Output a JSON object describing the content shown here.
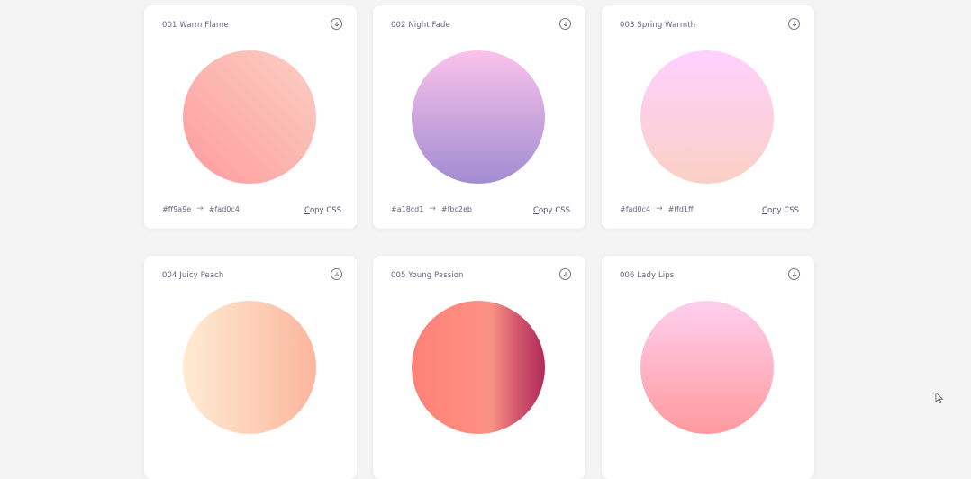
{
  "cards": [
    {
      "title": "001 Warm Flame",
      "from": "#ff9a9e",
      "to": "#fad0c4",
      "copy_first": "C",
      "copy_rest": "opy CSS",
      "gradient_direction": "to top right",
      "gradient_colors": [
        "#ff9a9e",
        "#fad0c4"
      ]
    },
    {
      "title": "002 Night Fade",
      "from": "#a18cd1",
      "to": "#fbc2eb",
      "copy_first": "C",
      "copy_rest": "opy CSS",
      "gradient_direction": "to top",
      "gradient_colors": [
        "#a18cd1",
        "#fbc2eb"
      ]
    },
    {
      "title": "003 Spring Warmth",
      "from": "#fad0c4",
      "to": "#ffd1ff",
      "copy_first": "C",
      "copy_rest": "opy CSS",
      "gradient_direction": "to top",
      "gradient_colors": [
        "#fad0c4",
        "#ffd1ff"
      ]
    },
    {
      "title": "004 Juicy Peach",
      "gradient_direction": "to right",
      "gradient_colors": [
        "#ffecd2",
        "#fcb69f"
      ]
    },
    {
      "title": "005 Young Passion",
      "gradient_direction": "to right",
      "gradient_colors": [
        "#ff8177",
        "#ff867a",
        "#ff8c7f",
        "#f99185",
        "#cf556c",
        "#b12a5b"
      ]
    },
    {
      "title": "006 Lady Lips",
      "gradient_direction": "to top",
      "gradient_colors": [
        "#ff9a9e",
        "#fecfef"
      ]
    }
  ],
  "icons": {
    "download": "download-circle-icon",
    "arrow": "→",
    "cursor": "mouse-pointer-icon"
  }
}
